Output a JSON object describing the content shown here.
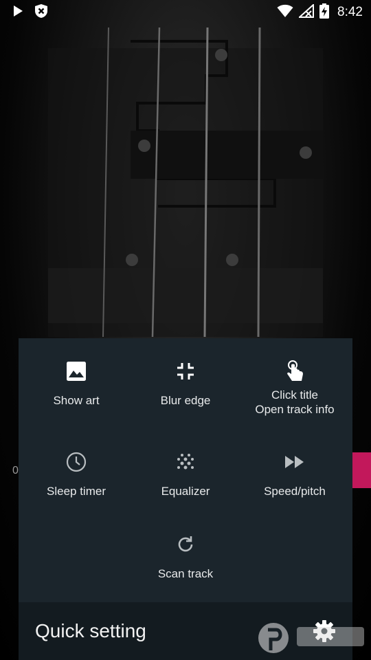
{
  "status_bar": {
    "time": "8:42"
  },
  "player_peek": {
    "left_text": "0"
  },
  "quick_settings": {
    "items": [
      {
        "label": "Show art"
      },
      {
        "label": "Blur edge"
      },
      {
        "label": "Click title",
        "sublabel": "Open track info"
      },
      {
        "label": "Sleep timer"
      },
      {
        "label": "Equalizer"
      },
      {
        "label": "Speed/pitch"
      },
      {
        "label": "Scan track"
      }
    ],
    "footer_title": "Quick setting"
  },
  "colors": {
    "sheet_bg": "#1b252c",
    "footer_bg": "#131b20",
    "accent": "#c2185b"
  }
}
